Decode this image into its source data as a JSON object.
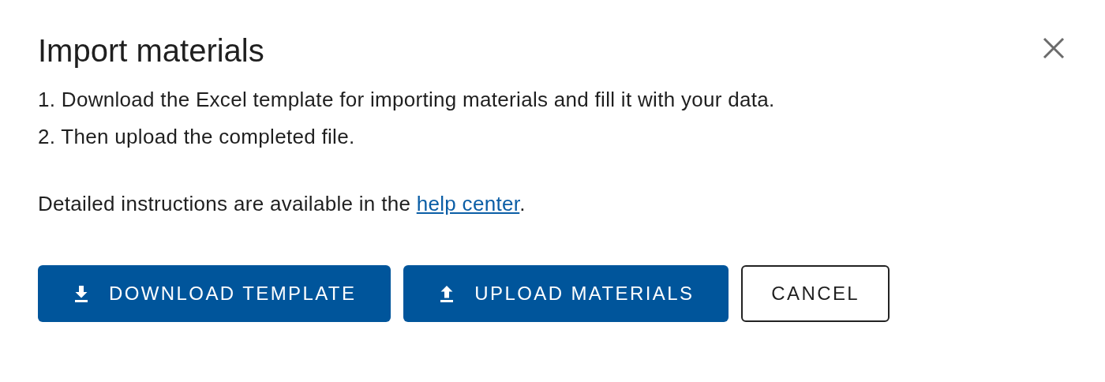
{
  "dialog": {
    "title": "Import materials",
    "steps": [
      "1. Download the Excel template for importing materials and fill it with your data.",
      "2. Then upload the completed file."
    ],
    "help_text": {
      "before": "Detailed instructions are available in the ",
      "link": "help center",
      "after": "."
    },
    "buttons": [
      {
        "label": "DOWNLOAD TEMPLATE",
        "kind": "download"
      },
      {
        "label": "UPLOAD MATERIALS",
        "kind": "upload"
      },
      {
        "label": "CANCEL",
        "kind": "outline"
      }
    ]
  }
}
